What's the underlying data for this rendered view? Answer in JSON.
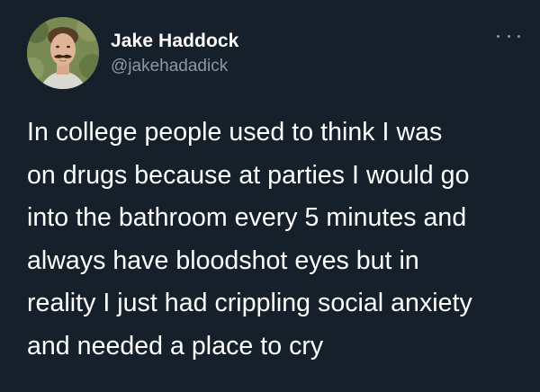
{
  "tweet": {
    "author": {
      "display_name": "Jake Haddock",
      "handle": "@jakehadadick"
    },
    "more_icon": "more-horizontal-icon",
    "text_lines": [
      "In college people used to think I was",
      "on drugs because at parties I would go",
      "into the bathroom every 5 minutes and",
      "always have bloodshot eyes but in",
      "reality I just had crippling social anxiety",
      "and needed a place to cry"
    ]
  },
  "colors": {
    "background": "#15202b",
    "primary_text": "#ffffff",
    "secondary_text": "#8b98a5"
  }
}
